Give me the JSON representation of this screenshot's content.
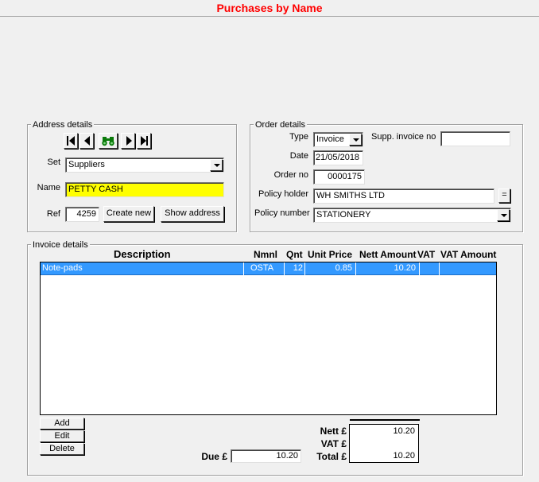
{
  "window": {
    "title": "Purchases by Name"
  },
  "address": {
    "legend": "Address details",
    "set_label": "Set",
    "set_value": "Suppliers",
    "name_label": "Name",
    "name_value": "PETTY CASH",
    "ref_label": "Ref",
    "ref_value": "4259",
    "create_new": "Create new",
    "show_address": "Show address"
  },
  "order": {
    "legend": "Order details",
    "type_label": "Type",
    "type_value": "Invoice",
    "supp_invoice_label": "Supp. invoice no",
    "supp_invoice_value": "",
    "date_label": "Date",
    "date_value": "21/05/2018",
    "order_no_label": "Order no",
    "order_no_value": "0000175",
    "policy_holder_label": "Policy holder",
    "policy_holder_value": "WH SMITHS LTD",
    "policy_holder_btn": "=",
    "policy_number_label": "Policy number",
    "policy_number_value": "STATIONERY"
  },
  "invoice": {
    "legend": "Invoice details",
    "columns": {
      "description": "Description",
      "nmnl": "Nmnl",
      "qnt": "Qnt",
      "unit_price": "Unit Price",
      "nett_amount": "Nett Amount",
      "vat": "VAT",
      "vat_amount": "VAT Amount"
    },
    "rows": [
      {
        "description": "Note-pads",
        "nmnl": "OSTA",
        "qnt": "12",
        "unit_price": "0.85",
        "nett_amount": "10.20",
        "vat": "",
        "vat_amount": ""
      }
    ],
    "buttons": {
      "add": "Add",
      "edit": "Edit",
      "delete": "Delete"
    }
  },
  "totals": {
    "due_label": "Due £",
    "due_value": "10.20",
    "nett_label": "Nett £",
    "nett_value": "10.20",
    "vat_label": "VAT £",
    "vat_value": "",
    "total_label": "Total £",
    "total_value": "10.20"
  },
  "colors": {
    "title": "#ff0000",
    "name_highlight": "#ffff00",
    "selection": "#3399ff"
  }
}
